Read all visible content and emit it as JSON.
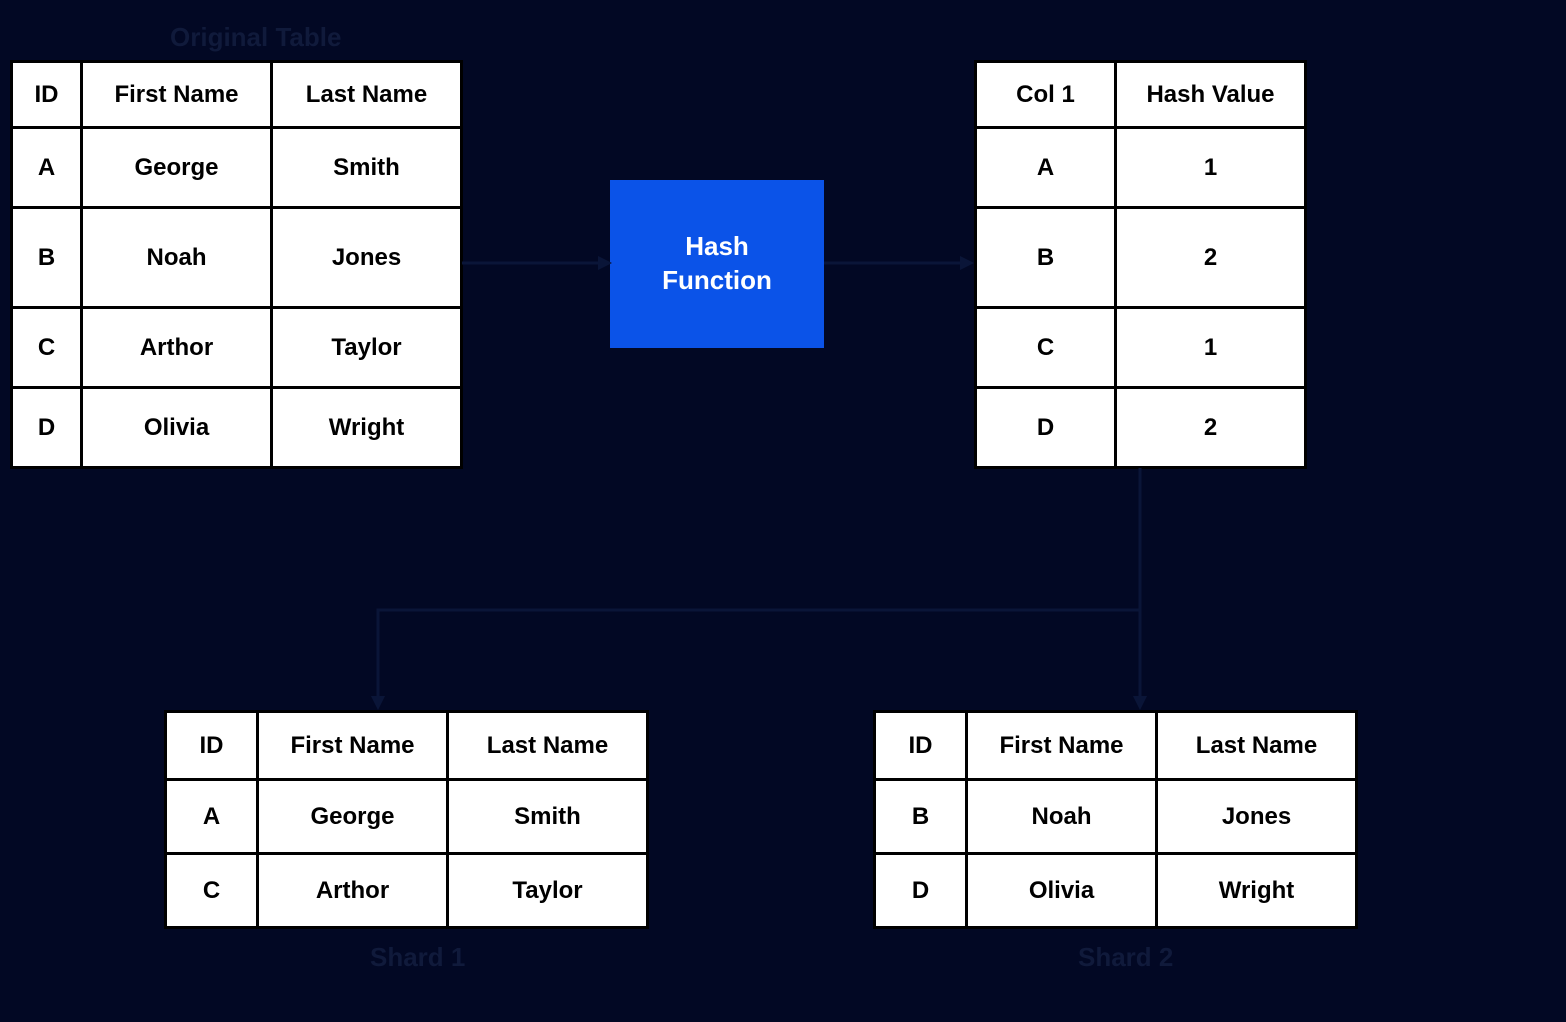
{
  "labels": {
    "original": "Original Table",
    "shard1": "Shard 1",
    "shard2": "Shard 2",
    "hash_function": "Hash\nFunction"
  },
  "original_table": {
    "headers": [
      "ID",
      "First Name",
      "Last Name"
    ],
    "rows": [
      [
        "A",
        "George",
        "Smith"
      ],
      [
        "B",
        "Noah",
        "Jones"
      ],
      [
        "C",
        "Arthor",
        "Taylor"
      ],
      [
        "D",
        "Olivia",
        "Wright"
      ]
    ]
  },
  "hash_table": {
    "headers": [
      "Col 1",
      "Hash Value"
    ],
    "rows": [
      [
        "A",
        "1"
      ],
      [
        "B",
        "2"
      ],
      [
        "C",
        "1"
      ],
      [
        "D",
        "2"
      ]
    ]
  },
  "shard1": {
    "headers": [
      "ID",
      "First Name",
      "Last Name"
    ],
    "rows": [
      [
        "A",
        "George",
        "Smith"
      ],
      [
        "C",
        "Arthor",
        "Taylor"
      ]
    ]
  },
  "shard2": {
    "headers": [
      "ID",
      "First Name",
      "Last Name"
    ],
    "rows": [
      [
        "B",
        "Noah",
        "Jones"
      ],
      [
        "D",
        "Olivia",
        "Wright"
      ]
    ]
  }
}
